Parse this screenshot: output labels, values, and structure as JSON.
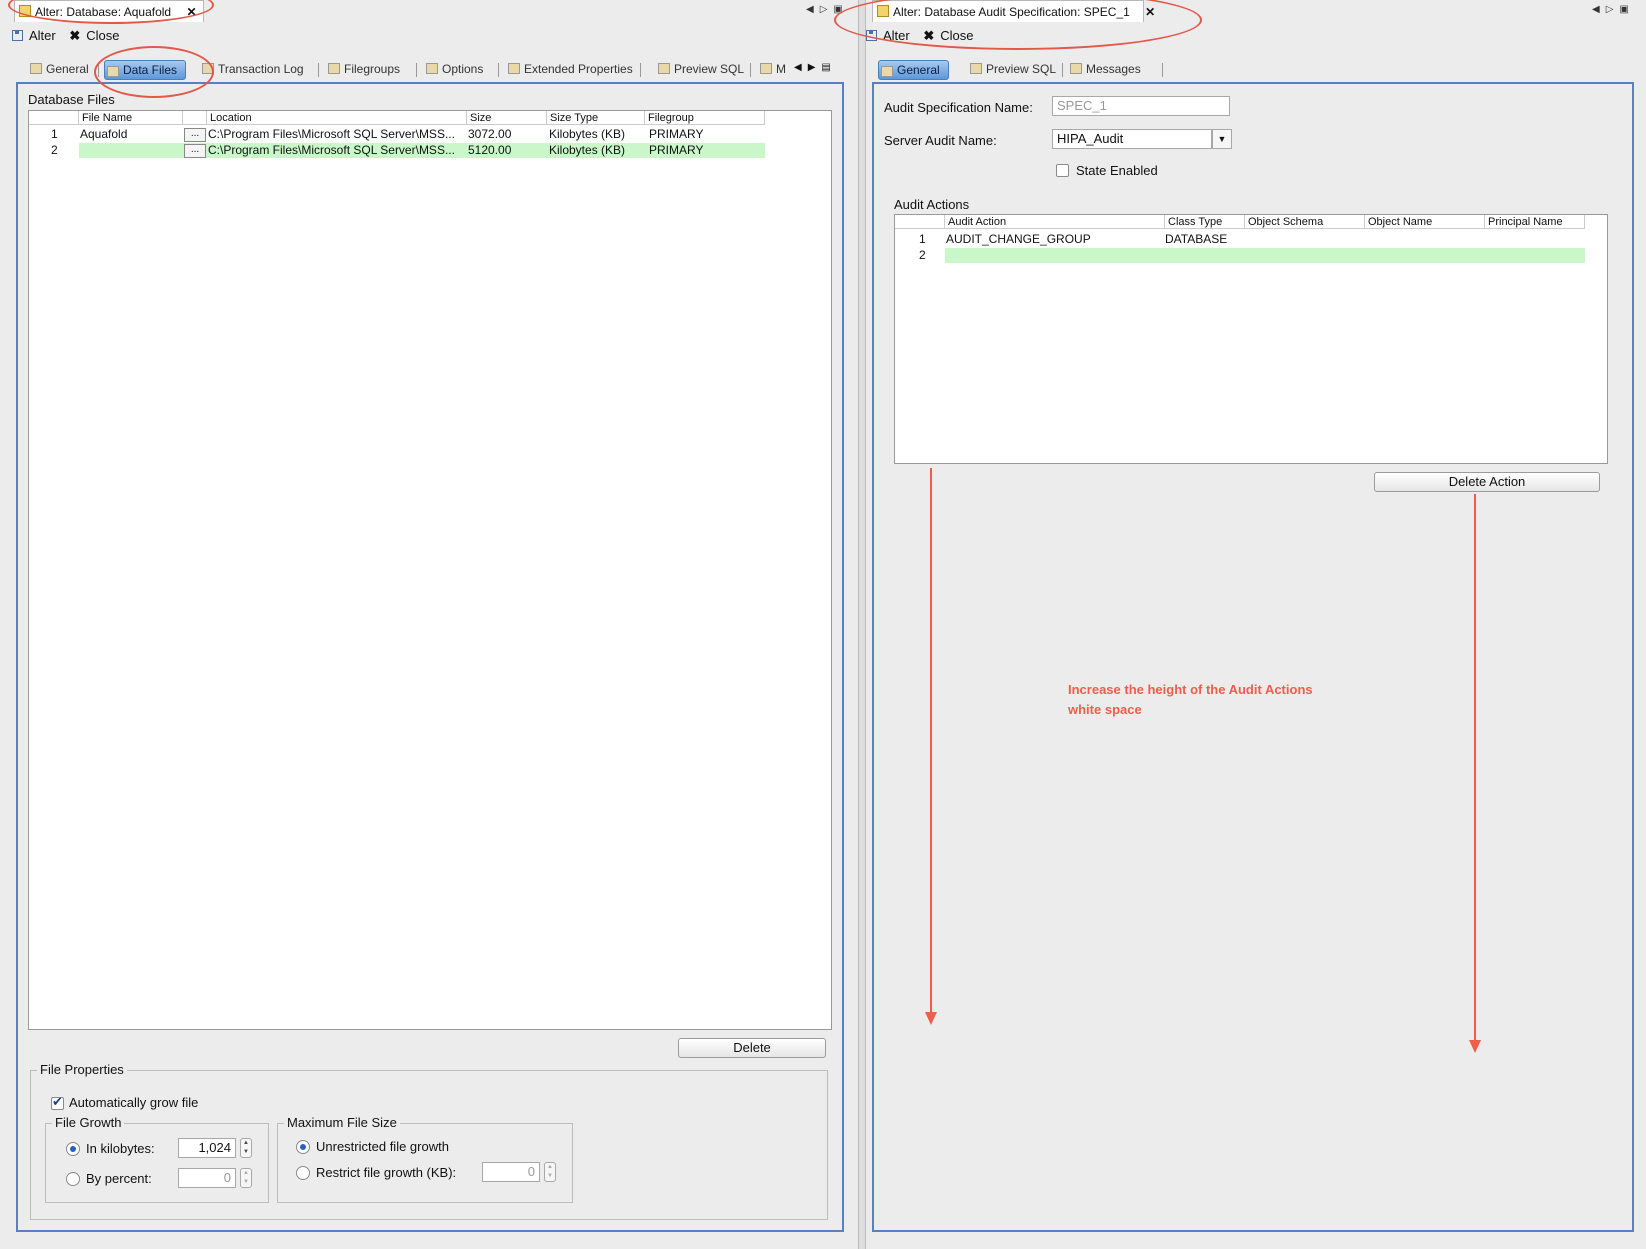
{
  "left": {
    "doc_tab": "Alter: Database: Aquafold",
    "toolbar": {
      "alter": "Alter",
      "close": "Close"
    },
    "tabs": [
      "General",
      "Data Files",
      "Transaction Log",
      "Filegroups",
      "Options",
      "Extended Properties",
      "Preview SQL",
      "M"
    ],
    "section_title": "Database Files",
    "columns": [
      "File Name",
      "Location",
      "Size",
      "Size Type",
      "Filegroup"
    ],
    "rows": [
      {
        "num": "1",
        "file_name": "Aquafold",
        "location": "C:\\Program Files\\Microsoft SQL Server\\MSS...",
        "size": "3072.00",
        "size_type": "Kilobytes (KB)",
        "filegroup": "PRIMARY"
      },
      {
        "num": "2",
        "file_name": "",
        "location": "C:\\Program Files\\Microsoft SQL Server\\MSS...",
        "size": "5120.00",
        "size_type": "Kilobytes (KB)",
        "filegroup": "PRIMARY"
      }
    ],
    "dots": "...",
    "delete_button": "Delete",
    "file_properties": {
      "title": "File Properties",
      "auto_grow": "Automatically grow file",
      "file_growth_title": "File Growth",
      "in_kilobytes": "In kilobytes:",
      "kb_value": "1,024",
      "by_percent": "By percent:",
      "percent_value": "0",
      "max_size_title": "Maximum File Size",
      "unrestricted": "Unrestricted file growth",
      "restrict": "Restrict file growth (KB):",
      "restrict_value": "0"
    }
  },
  "right": {
    "doc_tab": "Alter: Database Audit Specification: SPEC_1",
    "toolbar": {
      "alter": "Alter",
      "close": "Close"
    },
    "tabs": [
      "General",
      "Preview SQL",
      "Messages"
    ],
    "spec_name_label": "Audit Specification Name:",
    "spec_name_value": "SPEC_1",
    "server_audit_label": "Server Audit Name:",
    "server_audit_value": "HIPA_Audit",
    "state_enabled": "State Enabled",
    "audit_actions_title": "Audit Actions",
    "columns": [
      "Audit Action",
      "Class Type",
      "Object Schema",
      "Object Name",
      "Principal Name"
    ],
    "rows": [
      {
        "num": "1",
        "action": "AUDIT_CHANGE_GROUP",
        "class_type": "DATABASE"
      },
      {
        "num": "2",
        "action": "",
        "class_type": ""
      }
    ],
    "delete_action": "Delete Action"
  },
  "annotation": {
    "text": "Increase the height of the Audit Actions white space",
    "color": "#ee5e4a"
  }
}
